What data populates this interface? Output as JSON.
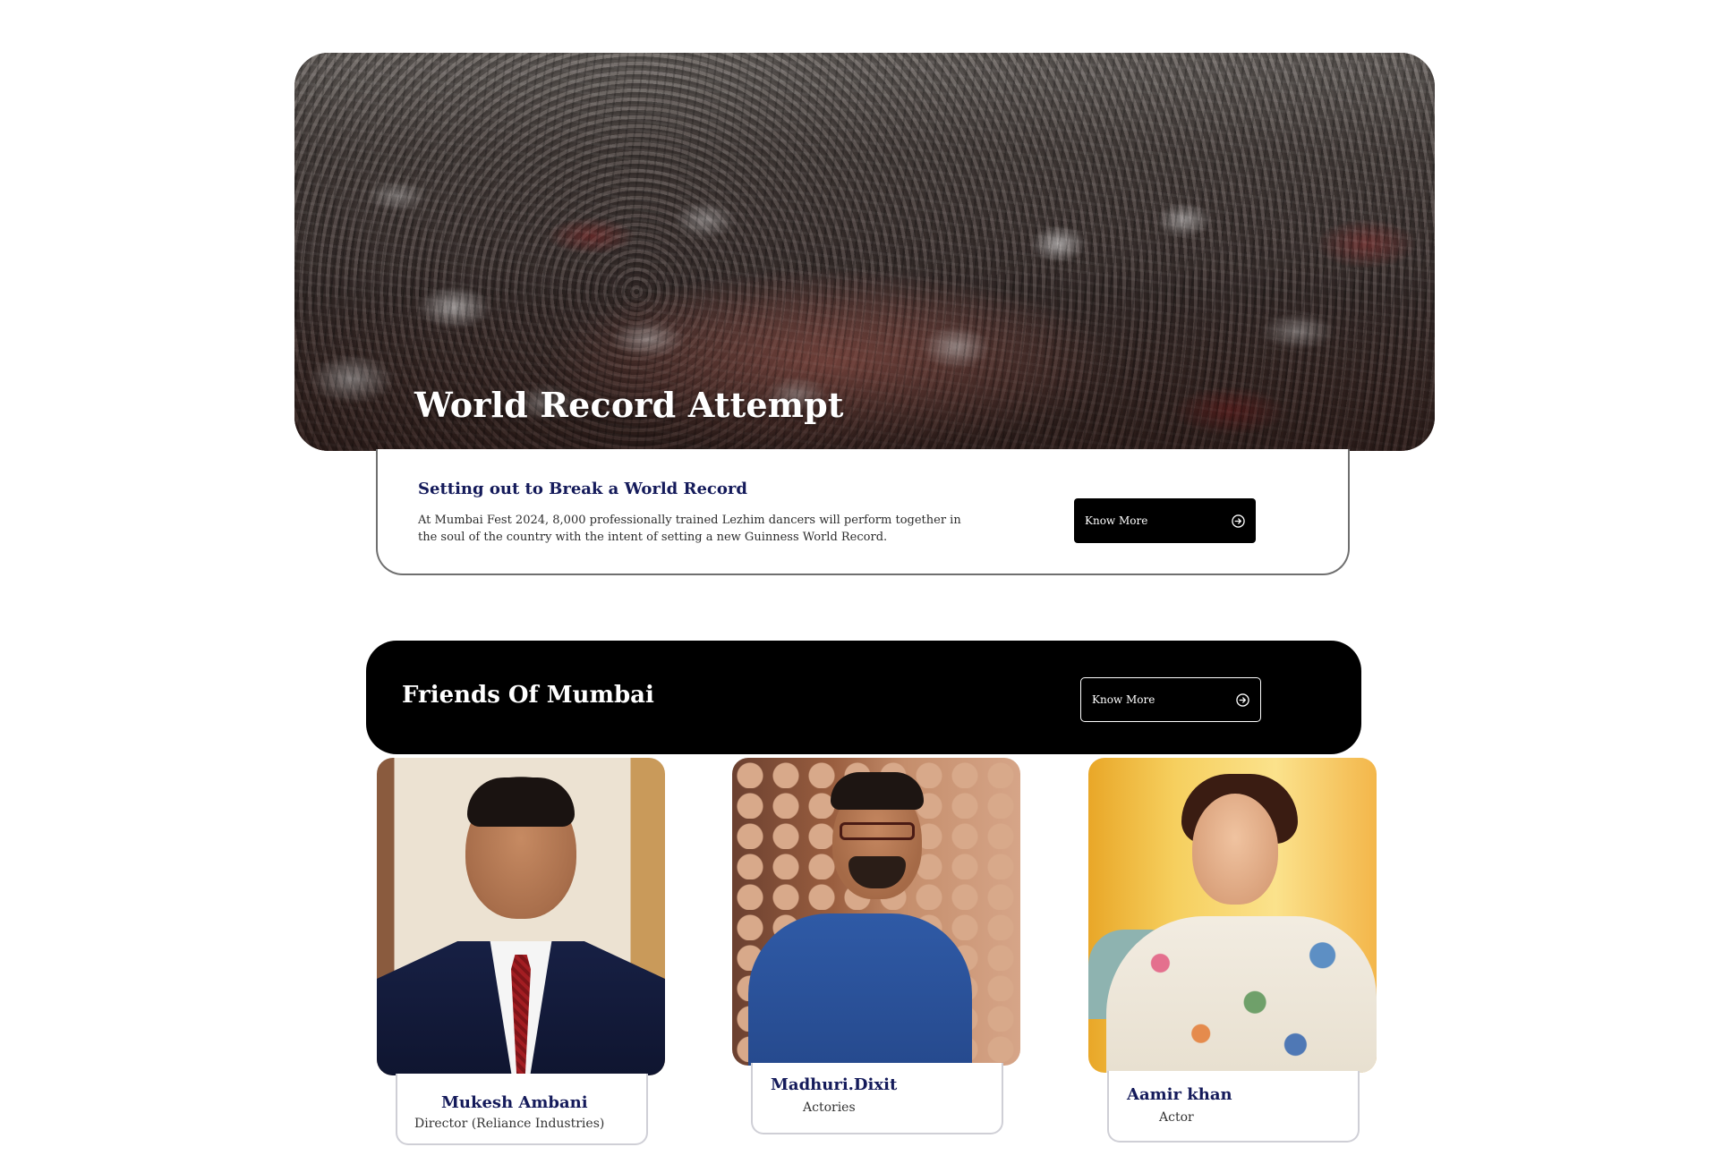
{
  "hero": {
    "title": "World Record Attempt"
  },
  "info": {
    "heading": "Setting out to Break a World Record",
    "description": "At Mumbai Fest 2024, 8,000 professionally trained Lezhim dancers will perform together in the soul of the country with the intent of setting a new Guinness World Record.",
    "button_label": "Know More",
    "button_icon": "arrow-right-circle-icon"
  },
  "friends": {
    "title": "Friends Of Mumbai",
    "button_label": "Know More",
    "button_icon": "arrow-right-circle-icon",
    "people": [
      {
        "name": "Mukesh Ambani",
        "role": "Director (Reliance Industries)"
      },
      {
        "name": "Madhuri.Dixit",
        "role": "Actories"
      },
      {
        "name": "Aamir khan",
        "role": "Actor"
      }
    ]
  },
  "colors": {
    "heading_navy": "#141a5a",
    "bar_black": "#000000",
    "button_black": "#000000",
    "card_border": "#6f6f6f"
  }
}
